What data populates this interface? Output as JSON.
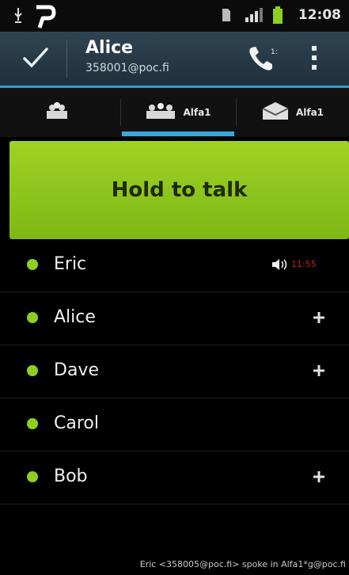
{
  "status_bar": {
    "clock": "12:08",
    "icons": [
      "usb-icon",
      "p-logo-icon",
      "sim-icon",
      "signal-icon",
      "battery-icon"
    ]
  },
  "action_bar": {
    "title": "Alice",
    "subtitle": "358001@poc.fi",
    "icons": [
      "check-icon",
      "phone-call-icon",
      "overflow-menu-icon"
    ]
  },
  "tabs": [
    {
      "label": "",
      "icon": "group-icon"
    },
    {
      "label": "Alfa1",
      "icon": "group-icon",
      "active": true
    },
    {
      "label": "Alfa1",
      "icon": "mailbox-icon"
    }
  ],
  "ptt_button": {
    "label": "Hold to talk"
  },
  "contacts": [
    {
      "name": "Eric",
      "status": "online",
      "speaking": true,
      "talk_time": "11:55"
    },
    {
      "name": "Alice",
      "status": "online",
      "action": "add"
    },
    {
      "name": "Dave",
      "status": "online",
      "action": "add"
    },
    {
      "name": "Carol",
      "status": "online"
    },
    {
      "name": "Bob",
      "status": "online",
      "action": "add"
    }
  ],
  "footer": {
    "message": "Eric <358005@poc.fi> spoke in Alfa1*g@poc.fi"
  },
  "colors": {
    "accent": "#3aa8d8",
    "ptt_green": "#8cc51f",
    "online_dot": "#8dd01f",
    "action_bar": "#283b48",
    "talk_time": "#c81f1f"
  }
}
